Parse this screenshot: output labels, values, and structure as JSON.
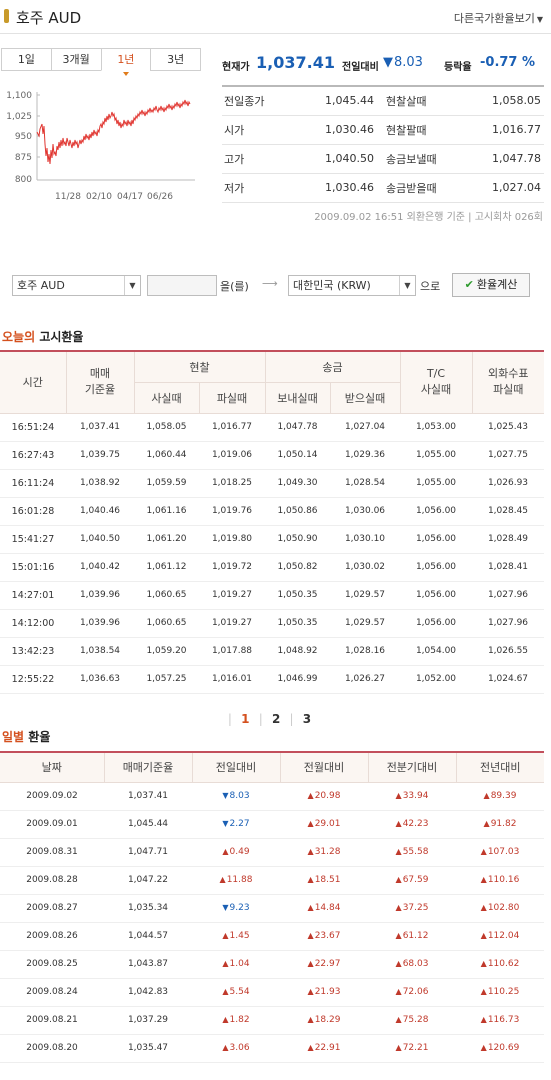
{
  "header": {
    "title": "호주 AUD",
    "other_currency": "다른국가환율보기"
  },
  "tabs": [
    "1일",
    "3개월",
    "1년",
    "3년"
  ],
  "active_tab": "1년",
  "mini_chart": {
    "y_ticks": [
      "1,100",
      "1,025",
      "950",
      "875",
      "800"
    ],
    "x_ticks": [
      "11/28",
      "02/10",
      "04/17",
      "06/26"
    ]
  },
  "summary": {
    "current_label": "현재가",
    "current_value": "1,037.41",
    "change_label": "전일대비",
    "change_value": "8.03",
    "rate_label": "등락율",
    "rate_value": "-0.77 %"
  },
  "info": [
    {
      "k1": "전일종가",
      "v1": "1,045.44",
      "k2": "현찰살때",
      "v2": "1,058.05"
    },
    {
      "k1": "시가",
      "v1": "1,030.46",
      "k2": "현찰팔때",
      "v2": "1,016.77"
    },
    {
      "k1": "고가",
      "v1": "1,040.50",
      "k2": "송금보낼때",
      "v2": "1,047.78"
    },
    {
      "k1": "저가",
      "v1": "1,030.46",
      "k2": "송금받을때",
      "v2": "1,027.04"
    }
  ],
  "note": "2009.09.02 16:51 외환은행 기준 | 고시회차 026회",
  "converter": {
    "from_currency": "호주 AUD",
    "particle": "을(를)",
    "arrow": "⟶",
    "to_currency": "대한민국 (KRW)",
    "suffix": "으로",
    "button": "환율계산"
  },
  "today_title": {
    "highlight": "오늘의",
    "rest": "고시환율"
  },
  "rates_headers": {
    "time": "시간",
    "base": "매매\n기준율",
    "cash": "현찰",
    "remit": "송금",
    "tc": "T/C\n사실때",
    "fcheck": "외화수표\n파실때",
    "cash_buy": "사실때",
    "cash_sell": "파실때",
    "remit_send": "보내실때",
    "remit_recv": "받으실때"
  },
  "rates": [
    [
      "16:51:24",
      "1,037.41",
      "1,058.05",
      "1,016.77",
      "1,047.78",
      "1,027.04",
      "1,053.00",
      "1,025.43"
    ],
    [
      "16:27:43",
      "1,039.75",
      "1,060.44",
      "1,019.06",
      "1,050.14",
      "1,029.36",
      "1,055.00",
      "1,027.75"
    ],
    [
      "16:11:24",
      "1,038.92",
      "1,059.59",
      "1,018.25",
      "1,049.30",
      "1,028.54",
      "1,055.00",
      "1,026.93"
    ],
    [
      "16:01:28",
      "1,040.46",
      "1,061.16",
      "1,019.76",
      "1,050.86",
      "1,030.06",
      "1,056.00",
      "1,028.45"
    ],
    [
      "15:41:27",
      "1,040.50",
      "1,061.20",
      "1,019.80",
      "1,050.90",
      "1,030.10",
      "1,056.00",
      "1,028.49"
    ],
    [
      "15:01:16",
      "1,040.42",
      "1,061.12",
      "1,019.72",
      "1,050.82",
      "1,030.02",
      "1,056.00",
      "1,028.41"
    ],
    [
      "14:27:01",
      "1,039.96",
      "1,060.65",
      "1,019.27",
      "1,050.35",
      "1,029.57",
      "1,056.00",
      "1,027.96"
    ],
    [
      "14:12:00",
      "1,039.96",
      "1,060.65",
      "1,019.27",
      "1,050.35",
      "1,029.57",
      "1,056.00",
      "1,027.96"
    ],
    [
      "13:42:23",
      "1,038.54",
      "1,059.20",
      "1,017.88",
      "1,048.92",
      "1,028.16",
      "1,054.00",
      "1,026.55"
    ],
    [
      "12:55:22",
      "1,036.63",
      "1,057.25",
      "1,016.01",
      "1,046.99",
      "1,026.27",
      "1,052.00",
      "1,024.67"
    ]
  ],
  "pager": [
    "1",
    "2",
    "3"
  ],
  "daily_title": {
    "highlight": "일별",
    "rest": "환율"
  },
  "daily_headers": [
    "날짜",
    "매매기준율",
    "전일대비",
    "전월대비",
    "전분기대비",
    "전년대비"
  ],
  "daily": [
    {
      "date": "2009.09.02",
      "base": "1,037.41",
      "d": [
        "dn",
        "8.03"
      ],
      "m": [
        "up",
        "20.98"
      ],
      "q": [
        "up",
        "33.94"
      ],
      "y": [
        "up",
        "89.39"
      ]
    },
    {
      "date": "2009.09.01",
      "base": "1,045.44",
      "d": [
        "dn",
        "2.27"
      ],
      "m": [
        "up",
        "29.01"
      ],
      "q": [
        "up",
        "42.23"
      ],
      "y": [
        "up",
        "91.82"
      ]
    },
    {
      "date": "2009.08.31",
      "base": "1,047.71",
      "d": [
        "up",
        "0.49"
      ],
      "m": [
        "up",
        "31.28"
      ],
      "q": [
        "up",
        "55.58"
      ],
      "y": [
        "up",
        "107.03"
      ]
    },
    {
      "date": "2009.08.28",
      "base": "1,047.22",
      "d": [
        "up",
        "11.88"
      ],
      "m": [
        "up",
        "18.51"
      ],
      "q": [
        "up",
        "67.59"
      ],
      "y": [
        "up",
        "110.16"
      ]
    },
    {
      "date": "2009.08.27",
      "base": "1,035.34",
      "d": [
        "dn",
        "9.23"
      ],
      "m": [
        "up",
        "14.84"
      ],
      "q": [
        "up",
        "37.25"
      ],
      "y": [
        "up",
        "102.80"
      ]
    },
    {
      "date": "2009.08.26",
      "base": "1,044.57",
      "d": [
        "up",
        "1.45"
      ],
      "m": [
        "up",
        "23.67"
      ],
      "q": [
        "up",
        "61.12"
      ],
      "y": [
        "up",
        "112.04"
      ]
    },
    {
      "date": "2009.08.25",
      "base": "1,043.87",
      "d": [
        "up",
        "1.04"
      ],
      "m": [
        "up",
        "22.97"
      ],
      "q": [
        "up",
        "68.03"
      ],
      "y": [
        "up",
        "110.62"
      ]
    },
    {
      "date": "2009.08.24",
      "base": "1,042.83",
      "d": [
        "up",
        "5.54"
      ],
      "m": [
        "up",
        "21.93"
      ],
      "q": [
        "up",
        "72.06"
      ],
      "y": [
        "up",
        "110.25"
      ]
    },
    {
      "date": "2009.08.21",
      "base": "1,037.29",
      "d": [
        "up",
        "1.82"
      ],
      "m": [
        "up",
        "18.29"
      ],
      "q": [
        "up",
        "75.28"
      ],
      "y": [
        "up",
        "116.73"
      ]
    },
    {
      "date": "2009.08.20",
      "base": "1,035.47",
      "d": [
        "up",
        "3.06"
      ],
      "m": [
        "up",
        "22.91"
      ],
      "q": [
        "up",
        "72.21"
      ],
      "y": [
        "up",
        "120.69"
      ]
    }
  ],
  "colors": {
    "accent": "#d4501e",
    "up": "#c0392b",
    "down": "#1a5fb4",
    "line": "#e0342f"
  }
}
